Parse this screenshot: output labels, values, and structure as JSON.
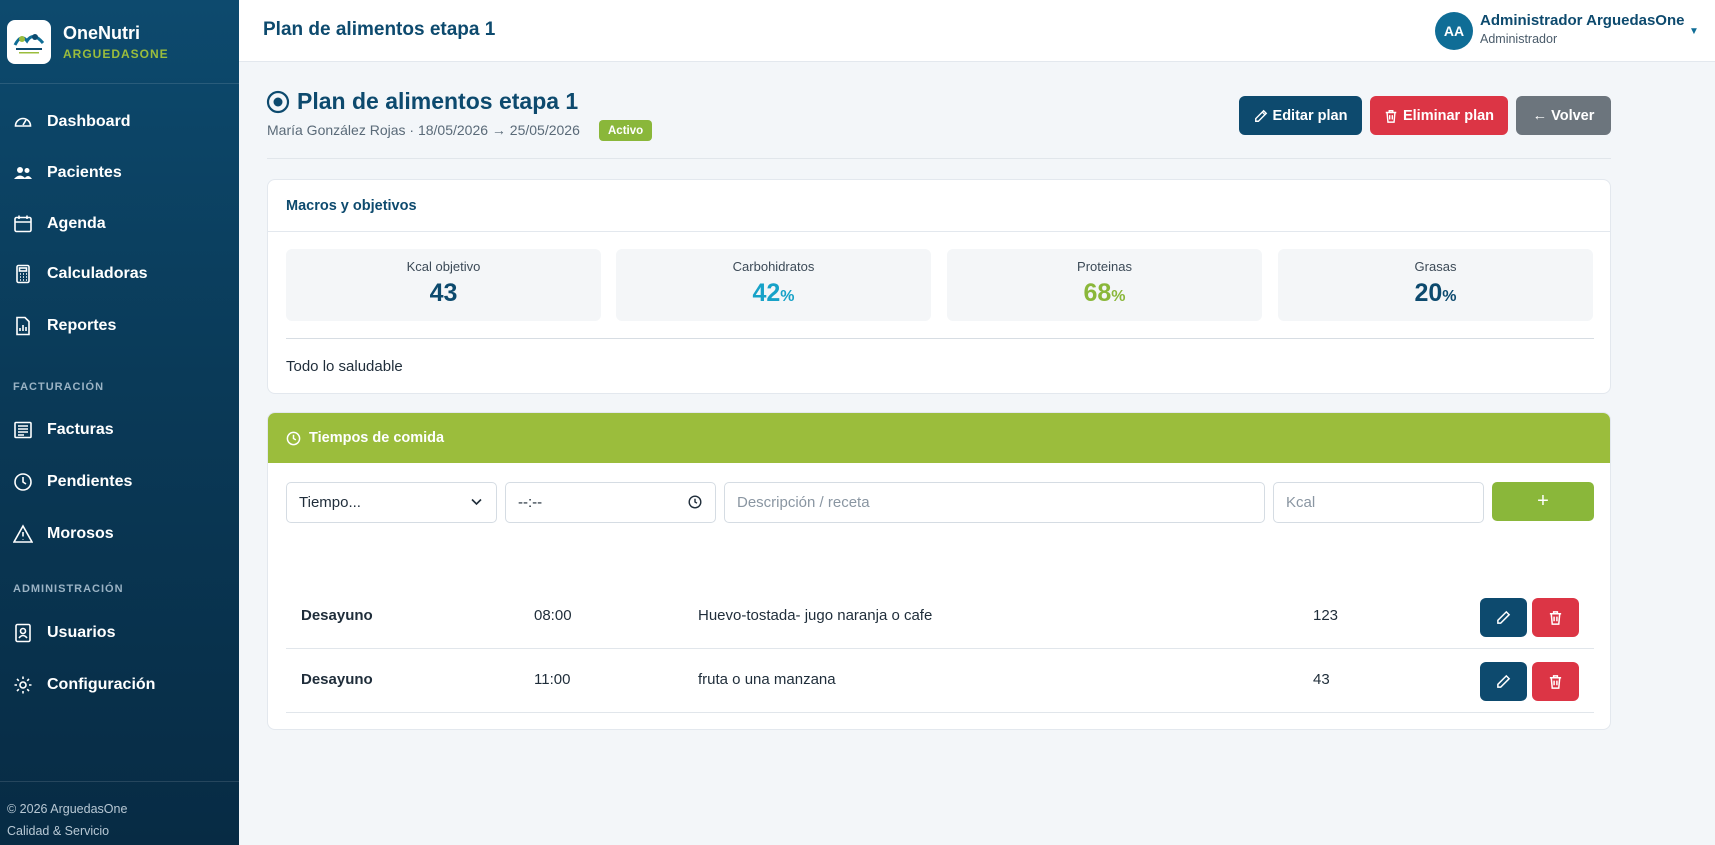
{
  "brand": {
    "name": "OneNutri",
    "sub": "ARGUEDASONE",
    "logo_text": "ArguedasOne"
  },
  "nav": {
    "items": [
      {
        "label": "Dashboard",
        "icon": "gauge-icon"
      },
      {
        "label": "Pacientes",
        "icon": "users-icon"
      },
      {
        "label": "Agenda",
        "icon": "calendar-icon"
      },
      {
        "label": "Calculadoras",
        "icon": "calculator-icon"
      },
      {
        "label": "Reportes",
        "icon": "report-icon"
      }
    ],
    "section_billing": "FACTURACIÓN",
    "billing_items": [
      {
        "label": "Facturas",
        "icon": "invoice-icon"
      },
      {
        "label": "Pendientes",
        "icon": "clock-icon"
      },
      {
        "label": "Morosos",
        "icon": "warning-icon"
      }
    ],
    "section_admin": "ADMINISTRACIÓN",
    "admin_items": [
      {
        "label": "Usuarios",
        "icon": "user-badge-icon"
      },
      {
        "label": "Configuración",
        "icon": "gear-icon"
      }
    ]
  },
  "footer": {
    "copyright": "© 2026 ArguedasOne",
    "tagline": "Calidad & Servicio"
  },
  "topbar": {
    "title": "Plan de alimentos etapa 1",
    "user_initials": "AA",
    "user_name": "Administrador ArguedasOne",
    "user_role": "Administrador"
  },
  "page": {
    "title": "Plan de alimentos etapa 1",
    "meta": "María González Rojas · 18/05/2026 → 25/05/2026",
    "status": "Activo",
    "edit_label": "Editar plan",
    "delete_label": "Eliminar plan",
    "back_label": "← Volver"
  },
  "macros": {
    "heading": "Macros y objetivos",
    "stats": [
      {
        "label": "Kcal objetivo",
        "value": "43",
        "unit": "",
        "color": "#0d4a6e"
      },
      {
        "label": "Carbohidratos",
        "value": "42",
        "unit": "%",
        "color": "#17a2c8"
      },
      {
        "label": "Proteinas",
        "value": "68",
        "unit": "%",
        "color": "#8ab73a"
      },
      {
        "label": "Grasas",
        "value": "20",
        "unit": "%",
        "color": "#0d4a6e"
      }
    ],
    "note": "Todo lo saludable"
  },
  "meals": {
    "heading": "Tiempos de comida",
    "form": {
      "tiempo_value": "Tiempo...",
      "time_value": "--:--",
      "desc_placeholder": "Descripción / receta",
      "kcal_placeholder": "Kcal",
      "add_label": "+"
    },
    "rows": [
      {
        "name": "Desayuno",
        "time": "08:00",
        "desc": "Huevo-tostada- jugo naranja o cafe",
        "kcal": "123"
      },
      {
        "name": "Desayuno",
        "time": "11:00",
        "desc": "fruta o una manzana",
        "kcal": "43"
      }
    ]
  },
  "colors": {
    "primary": "#0d4a6e",
    "accent_green": "#9bbd3c",
    "danger": "#dc3545",
    "muted": "#6c757d"
  }
}
